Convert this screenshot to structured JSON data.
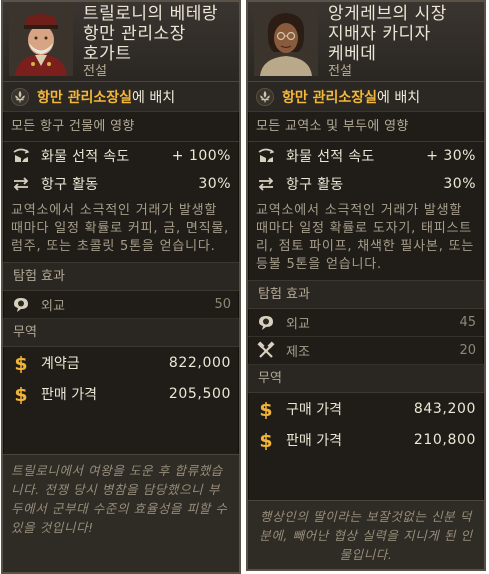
{
  "cards": [
    {
      "name_lines": [
        "트릴로니의 베테랑",
        "항만 관리소장",
        "호가트"
      ],
      "rarity": "전설",
      "placement": {
        "highlight": "항만 관리소장실",
        "suffix": "에 배치"
      },
      "scope": "모든 항구 건물에 영향",
      "stats": [
        {
          "icon": "cargo-speed-icon",
          "label": "화물 선적 속도",
          "value": "+ 100%"
        },
        {
          "icon": "swap-arrows-icon",
          "label": "항구 활동",
          "value": "30%"
        }
      ],
      "description": "교역소에서 소극적인 거래가 발생할 때마다 일정 확률로 커피, 금, 면직물, 럼주, 또는 초콜릿 5톤을 얻습니다.",
      "expedition_title": "탐험 효과",
      "skills": [
        {
          "icon": "diplomacy-icon",
          "label": "외교",
          "value": "50"
        }
      ],
      "trade_title": "무역",
      "trade": [
        {
          "icon": "dollar-icon",
          "label": "계약금",
          "value": "822,000"
        },
        {
          "icon": "dollar-icon",
          "label": "판매 가격",
          "value": "205,500"
        }
      ],
      "flavor": "트릴로니에서 여왕을 도운 후 합류했습니다. 전쟁 당시 병참을 담당했으니 부두에서 군부대 수준의 효율성을 피할 수 있을 것입니다!"
    },
    {
      "name_lines": [
        "앙게레브의 시장",
        "지배자 카디자",
        "케베데"
      ],
      "rarity": "전설",
      "placement": {
        "highlight": "항만 관리소장실",
        "suffix": "에 배치"
      },
      "scope": "모든 교역소 및 부두에 영향",
      "stats": [
        {
          "icon": "cargo-speed-icon",
          "label": "화물 선적 속도",
          "value": "+ 30%"
        },
        {
          "icon": "swap-arrows-icon",
          "label": "항구 활동",
          "value": "30%"
        }
      ],
      "description": "교역소에서 소극적인 거래가 발생할 때마다 일정 확률로 도자기, 태피스트리, 점토 파이프, 채색한 필사본, 또는 등불 5톤을 얻습니다.",
      "expedition_title": "탐험 효과",
      "skills": [
        {
          "icon": "diplomacy-icon",
          "label": "외교",
          "value": "45"
        },
        {
          "icon": "crafting-icon",
          "label": "제조",
          "value": "20"
        }
      ],
      "trade_title": "무역",
      "trade": [
        {
          "icon": "dollar-icon",
          "label": "구매 가격",
          "value": "843,200"
        },
        {
          "icon": "dollar-icon",
          "label": "판매 가격",
          "value": "210,800"
        }
      ],
      "flavor": "행상인의 딸이라는 보잘것없는 신분 덕분에, 빼어난 협상 실력을 지니게 된 인물입니다."
    }
  ],
  "colors": {
    "highlight": "#f3b73a",
    "panel": "#201d18",
    "text": "#ece6d6",
    "muted": "#a69d8b"
  }
}
